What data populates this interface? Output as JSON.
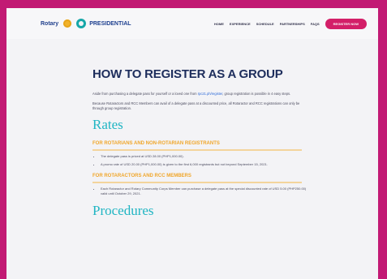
{
  "header": {
    "rotary_text": "Rotary",
    "logo_text": "PRESIDENTIAL",
    "nav": [
      "HOME",
      "EXPERIENCE",
      "SCHEDULE",
      "PARTNERSHIPS",
      "FAQS"
    ],
    "register_label": "REGISTER NOW"
  },
  "main": {
    "title": "HOW TO REGISTER AS A GROUP",
    "para1_prefix": "Aside from purchasing a delegate pass for yourself or a loved one from",
    "para1_link": "rpc21.ph/register",
    "para1_suffix": ", group registration is possible in 4 easy steps.",
    "para2": "Because Rotaractors and RCC Members can avail of a delegate pass at a discounted price, all Rotaractor and RCC registrations can only be through group registration.",
    "rates_title": "Rates",
    "rotarians_heading": "FOR ROTARIANS AND NON-ROTARIAN REGISTRANTS",
    "rotarians_bullets": [
      "The delegate pass is priced at USD 28.00 (PHP1,000.00).",
      "A promo rate of USD 20.00 (PHP1,000.00) is given to the first 6,000 registrants but not beyond September 15, 2021."
    ],
    "rotaractors_heading": "FOR ROTARACTORS AND RCC MEMBERS",
    "rotaractors_bullets": [
      "Each Rotaractor and Rotary Community Corps Member can purchase a delegate pass at the special discounted rate of USD 5.00 (PHP250.00) valid until October 29, 2021."
    ],
    "procedures_title": "Procedures"
  }
}
